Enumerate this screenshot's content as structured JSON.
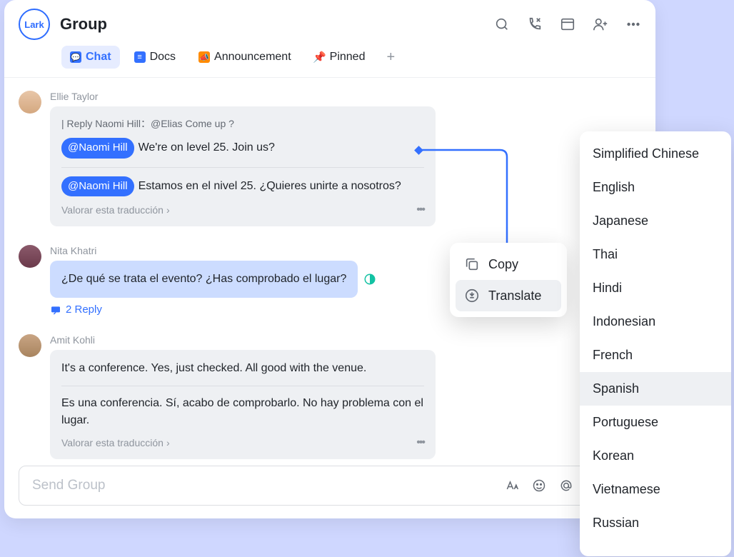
{
  "header": {
    "logo": "Lark",
    "title": "Group",
    "tabs": [
      "Chat",
      "Docs",
      "Announcement",
      "Pinned"
    ]
  },
  "messages": [
    {
      "sender": "Ellie Taylor",
      "quote": "| Reply Naomi Hill：@Elias Come up ?",
      "mention": "@Naomi Hill",
      "original": "We're on level 25. Join us?",
      "translated": "Estamos en el nivel 25. ¿Quieres unirte a nosotros?",
      "rate": "Valorar esta traducción"
    },
    {
      "sender": "Nita Khatri",
      "text": "¿De qué se trata el evento? ¿Has comprobado el lugar?",
      "reply_count": "2 Reply"
    },
    {
      "sender": "Amit Kohli",
      "original": "It's a conference. Yes, just checked. All good with the venue.",
      "translated": "Es una conferencia. Sí, acabo de comprobarlo. No hay problema con el lugar.",
      "rate": "Valorar esta traducción"
    }
  ],
  "composer": {
    "placeholder": "Send Group"
  },
  "context_menu": {
    "copy": "Copy",
    "translate": "Translate"
  },
  "languages": [
    "Simplified Chinese",
    "English",
    "Japanese",
    "Thai",
    "Hindi",
    "Indonesian",
    "French",
    "Spanish",
    "Portuguese",
    "Korean",
    "Vietnamese",
    "Russian"
  ],
  "selected_language": "Spanish"
}
